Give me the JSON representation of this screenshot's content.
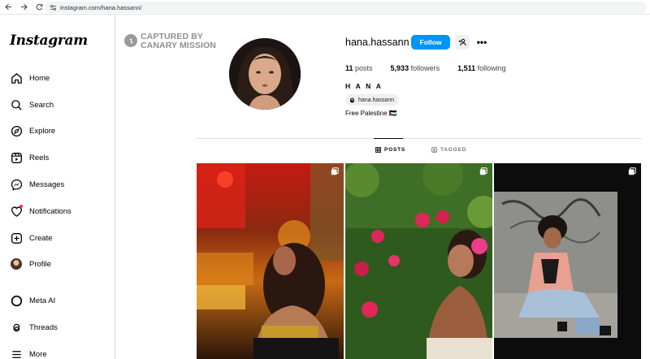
{
  "browser": {
    "url": "instagram.com/hana.hassann/"
  },
  "sidebar": {
    "logo": "Instagram",
    "items": [
      {
        "label": "Home",
        "icon": "home-icon"
      },
      {
        "label": "Search",
        "icon": "search-icon"
      },
      {
        "label": "Explore",
        "icon": "compass-icon"
      },
      {
        "label": "Reels",
        "icon": "reels-icon"
      },
      {
        "label": "Messages",
        "icon": "messenger-icon"
      },
      {
        "label": "Notifications",
        "icon": "heart-icon"
      },
      {
        "label": "Create",
        "icon": "plus-square-icon"
      },
      {
        "label": "Profile",
        "icon": "profile-avatar"
      },
      {
        "label": "Meta AI",
        "icon": "meta-ai-icon"
      },
      {
        "label": "Threads",
        "icon": "threads-icon"
      },
      {
        "label": "More",
        "icon": "menu-icon"
      }
    ]
  },
  "watermark": {
    "line1": "CAPTURED BY",
    "line2": "CANARY MISSION"
  },
  "profile": {
    "username": "hana.hassann",
    "follow_label": "Follow",
    "more_label": "•••",
    "posts_count": "11",
    "posts_label": "posts",
    "followers_count": "5,933",
    "followers_label": "followers",
    "following_count": "1,511",
    "following_label": "following",
    "full_name": "H A N A",
    "threads_handle": "hana.hassann",
    "bio": "Free Palestine 🇵🇸"
  },
  "tabs": {
    "posts_label": "POSTS",
    "tagged_label": "TAGGED"
  },
  "colors": {
    "follow_blue": "#0095f6",
    "notification_red": "#ff3040",
    "divider": "#dbdbdb"
  }
}
